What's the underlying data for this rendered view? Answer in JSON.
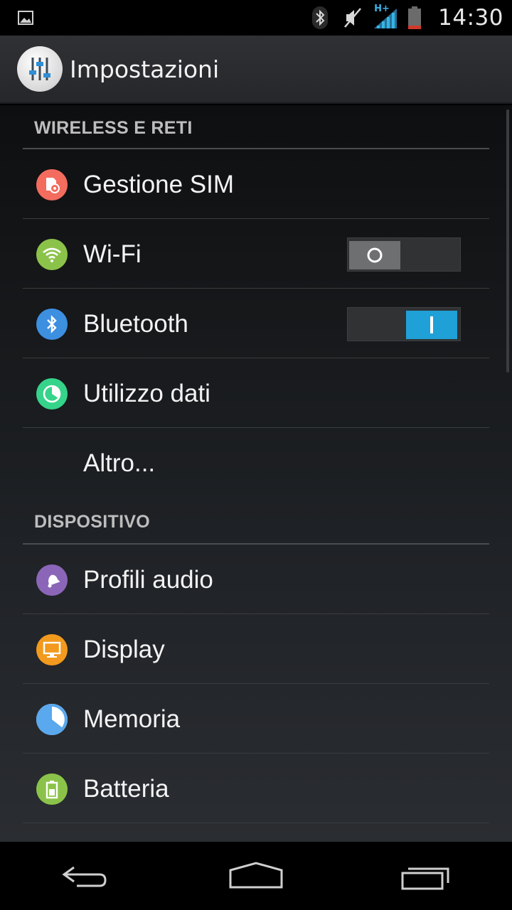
{
  "status_bar": {
    "time": "14:30",
    "network_type": "H+",
    "icons": [
      "image-notification-icon",
      "bluetooth-icon",
      "vibrate-icon",
      "signal-icon",
      "battery-icon"
    ]
  },
  "action_bar": {
    "title": "Impostazioni",
    "icon": "settings-sliders-icon"
  },
  "sections": {
    "wireless": {
      "header": "WIRELESS E RETI",
      "items": [
        {
          "label": "Gestione SIM",
          "icon": "sim-management-icon",
          "color": "#f36c5e"
        },
        {
          "label": "Wi-Fi",
          "icon": "wifi-icon",
          "color": "#8bc34a",
          "toggle": "off"
        },
        {
          "label": "Bluetooth",
          "icon": "bluetooth-icon",
          "color": "#3d8fe0",
          "toggle": "on"
        },
        {
          "label": "Utilizzo dati",
          "icon": "data-usage-icon",
          "color": "#35d48a"
        },
        {
          "label": "Altro..."
        }
      ]
    },
    "device": {
      "header": "DISPOSITIVO",
      "items": [
        {
          "label": "Profili audio",
          "icon": "audio-profiles-icon",
          "color": "#8b66b8"
        },
        {
          "label": "Display",
          "icon": "display-icon",
          "color": "#f29a1e"
        },
        {
          "label": "Memoria",
          "icon": "storage-icon",
          "color": "#5aa8ee"
        },
        {
          "label": "Batteria",
          "icon": "battery-icon",
          "color": "#8bc34a"
        }
      ]
    }
  },
  "colors": {
    "accent": "#1fa0d6",
    "toggle_off": "#6d6f71",
    "section_text": "#bdbdbd"
  }
}
